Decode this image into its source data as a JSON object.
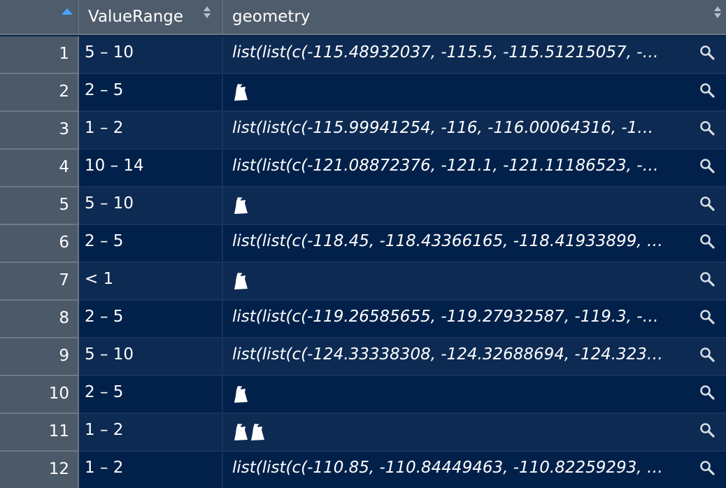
{
  "table": {
    "columns": [
      {
        "key": "index",
        "label": ""
      },
      {
        "key": "ValueRange",
        "label": "ValueRange"
      },
      {
        "key": "geometry",
        "label": "geometry"
      }
    ],
    "sort": {
      "column": "index",
      "direction": "ascending"
    },
    "rows": [
      {
        "index": "1",
        "value_range": "5 – 10",
        "geometry": "list(list(c(-115.48932037, -115.5, -115.51215057, -…",
        "geometry_icon": null
      },
      {
        "index": "2",
        "value_range": "2 – 5",
        "geometry": "",
        "geometry_icon": "polygon-glyph-icon"
      },
      {
        "index": "3",
        "value_range": "1 – 2",
        "geometry": "list(list(c(-115.99941254, -116, -116.00064316, -1…",
        "geometry_icon": null
      },
      {
        "index": "4",
        "value_range": "10 – 14",
        "geometry": "list(list(c(-121.08872376, -121.1, -121.11186523, -…",
        "geometry_icon": null
      },
      {
        "index": "5",
        "value_range": "5 – 10",
        "geometry": "",
        "geometry_icon": "polygon-glyph-icon"
      },
      {
        "index": "6",
        "value_range": "2 – 5",
        "geometry": "list(list(c(-118.45, -118.43366165, -118.41933899, …",
        "geometry_icon": null
      },
      {
        "index": "7",
        "value_range": "< 1",
        "geometry": "",
        "geometry_icon": "polygon-glyph-icon"
      },
      {
        "index": "8",
        "value_range": "2 – 5",
        "geometry": "list(list(c(-119.26585655, -119.27932587, -119.3, -…",
        "geometry_icon": null
      },
      {
        "index": "9",
        "value_range": "5 – 10",
        "geometry": "list(list(c(-124.33338308, -124.32688694, -124.323…",
        "geometry_icon": null
      },
      {
        "index": "10",
        "value_range": "2 – 5",
        "geometry": "",
        "geometry_icon": "polygon-glyph-icon"
      },
      {
        "index": "11",
        "value_range": "1 – 2",
        "geometry": "",
        "geometry_icon": "polygon-glyph-double-icon"
      },
      {
        "index": "12",
        "value_range": "1 – 2",
        "geometry": "list(list(c(-110.85, -110.84449463, -110.82259293, …",
        "geometry_icon": null
      }
    ]
  },
  "icons": {
    "sort_ascending": "sort-ascending-icon",
    "sort_both": "sort-both-icon",
    "view_cell": "magnifier-icon"
  },
  "colors": {
    "header_bg": "#4e5c6b",
    "index_bg": "#4b5968",
    "row_odd": "#0d2a52",
    "row_even": "#02214a",
    "sort_active": "#4aa3ff",
    "text": "#ffffff"
  }
}
